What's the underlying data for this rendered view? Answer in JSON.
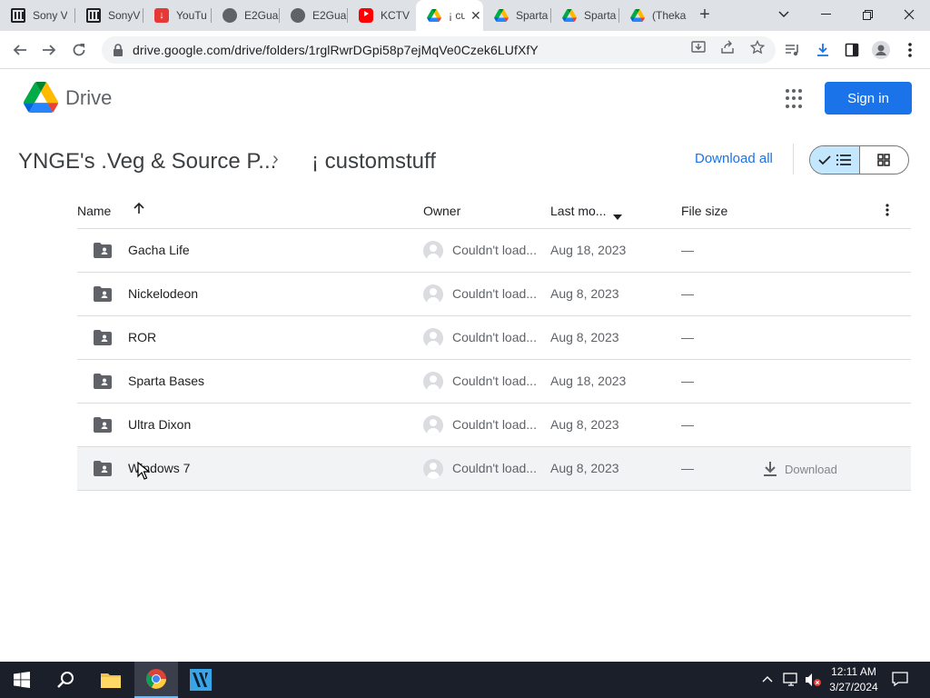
{
  "browser": {
    "tabs": [
      {
        "label": "Sony V",
        "icon": "sony-icon"
      },
      {
        "label": "SonyV",
        "icon": "sony-icon"
      },
      {
        "label": "YouTu",
        "icon": "download-icon"
      },
      {
        "label": "E2Gua",
        "icon": "globe-icon"
      },
      {
        "label": "E2Gua",
        "icon": "globe-icon"
      },
      {
        "label": "KCTV",
        "icon": "youtube-icon"
      },
      {
        "label": "¡ cu",
        "icon": "google-drive-icon"
      },
      {
        "label": "Sparta",
        "icon": "google-drive-icon"
      },
      {
        "label": "Sparta",
        "icon": "google-drive-icon"
      },
      {
        "label": "(Theka",
        "icon": "google-drive-icon"
      }
    ],
    "new_tab": "+",
    "url": "drive.google.com/drive/folders/1rglRwrDGpi58p7ejMqVe0Czek6LUfXfY"
  },
  "drive": {
    "app_name": "Drive",
    "sign_in_label": "Sign in"
  },
  "breadcrumb": {
    "parent": "YNGE's .Veg & Source P...",
    "separator": "›",
    "current": "¡ customstuff"
  },
  "actions": {
    "download_all": "Download all"
  },
  "table": {
    "headers": {
      "name": "Name",
      "owner": "Owner",
      "modified": "Last mo...",
      "size": "File size"
    },
    "rows": [
      {
        "name": "Gacha Life",
        "owner": "Couldn't load...",
        "modified": "Aug 18, 2023",
        "size": "—"
      },
      {
        "name": "Nickelodeon",
        "owner": "Couldn't load...",
        "modified": "Aug 8, 2023",
        "size": "—"
      },
      {
        "name": "ROR",
        "owner": "Couldn't load...",
        "modified": "Aug 8, 2023",
        "size": "—"
      },
      {
        "name": "Sparta Bases",
        "owner": "Couldn't load...",
        "modified": "Aug 18, 2023",
        "size": "—"
      },
      {
        "name": "Ultra Dixon",
        "owner": "Couldn't load...",
        "modified": "Aug 8, 2023",
        "size": "—"
      },
      {
        "name": "Windows 7",
        "owner": "Couldn't load...",
        "modified": "Aug 8, 2023",
        "size": "—",
        "hover_action": "Download"
      }
    ]
  },
  "taskbar": {
    "time": "12:11 AM",
    "date": "3/27/2024"
  },
  "colors": {
    "accent": "#1a73e8",
    "view_toggle_active": "#c2e7ff",
    "taskbar": "#1b1f2a"
  }
}
